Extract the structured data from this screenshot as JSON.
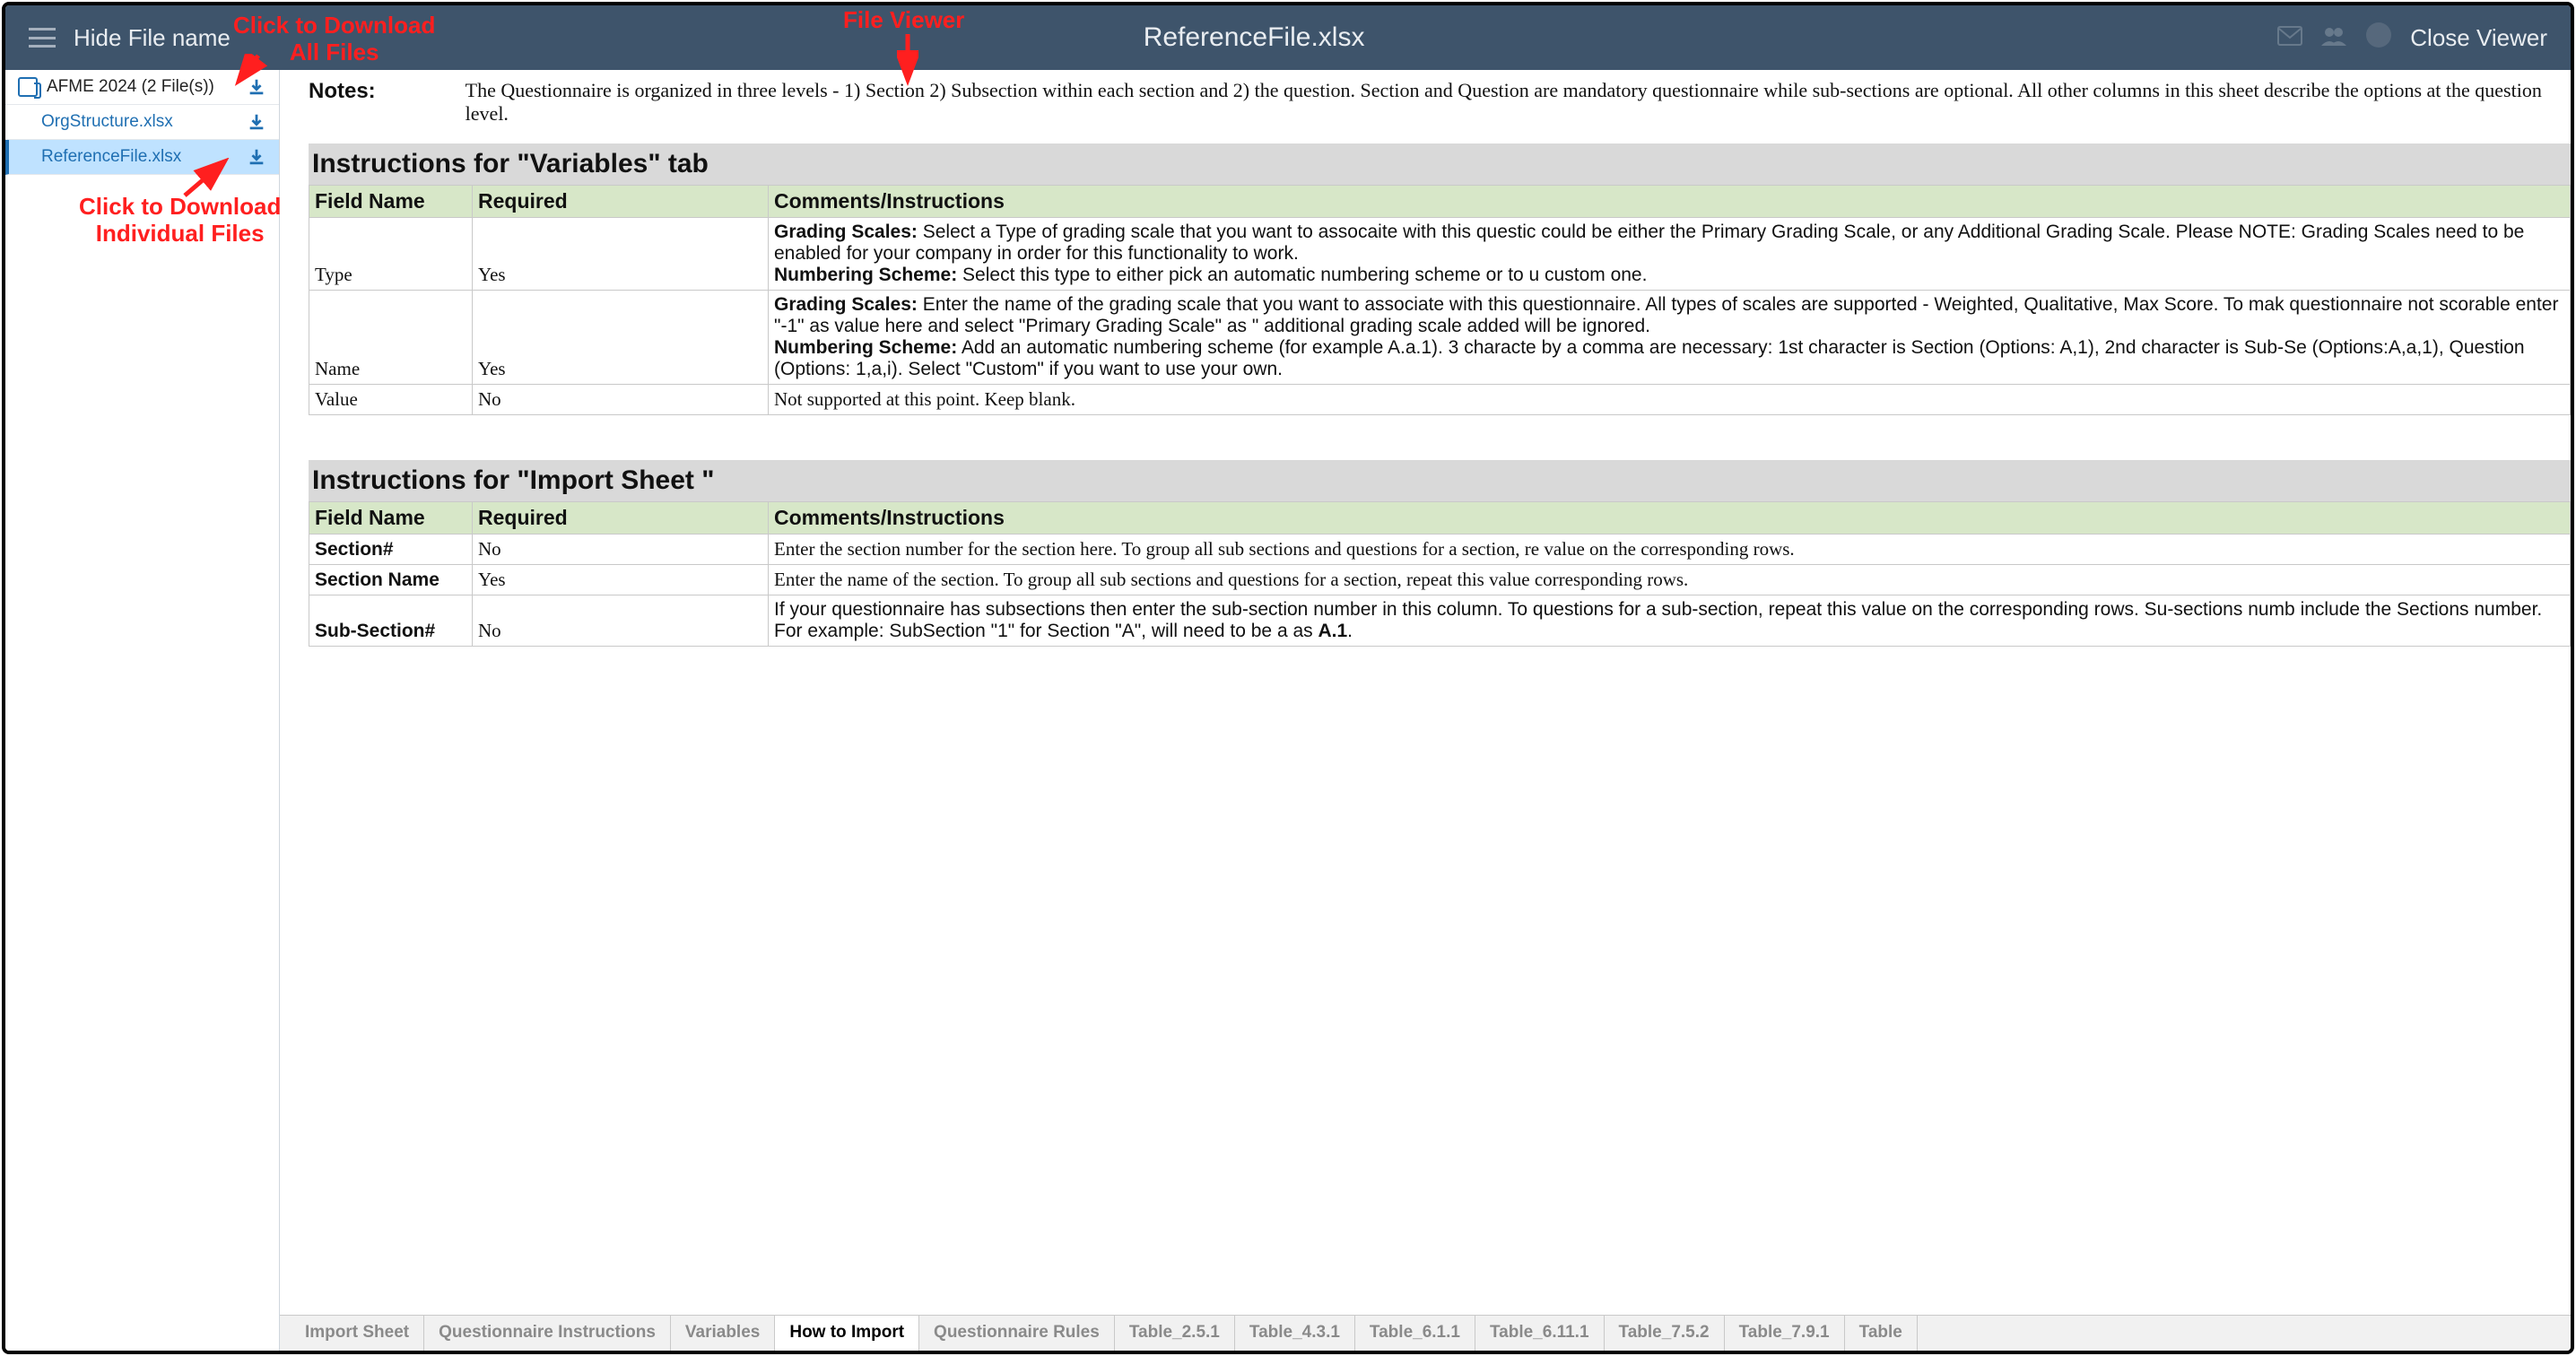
{
  "header": {
    "hide_filename_label": "Hide File name",
    "title": "ReferenceFile.xlsx",
    "close_label": "Close Viewer"
  },
  "sidebar": {
    "folder": {
      "name": "AFME 2024 (2 File(s))"
    },
    "files": [
      {
        "name": "OrgStructure.xlsx",
        "active": false
      },
      {
        "name": "ReferenceFile.xlsx",
        "active": true
      }
    ]
  },
  "document": {
    "notes_label": "Notes:",
    "notes_text": "The Questionnaire is organized in three levels - 1) Section 2) Subsection within each section and 2) the question. Section and Question are mandatory questionnaire while sub-sections are optional. All other columns in this sheet describe the options at the question level.",
    "sections": [
      {
        "title": "Instructions for \"Variables\" tab",
        "headers": [
          "Field Name",
          "Required",
          "Comments/Instructions"
        ],
        "rows": [
          {
            "field": "Type",
            "required": "Yes",
            "comments_html": "<b>Grading Scales:</b> Select a Type of grading scale that you want to assocaite with this questic could be either the Primary Grading Scale, or any Additional Grading Scale. Please NOTE: Grading Scales need to be enabled for your company in order for this functionality to work. <br><b>Numbering Scheme:</b> Select this type to either pick an automatic numbering scheme or to u custom one.",
            "serif": false
          },
          {
            "field": "Name",
            "required": "Yes",
            "comments_html": "<b>Grading Scales:</b> Enter the name of the grading scale that you want to associate with this questionnaire. All types of scales are supported - Weighted, Qualitative, Max Score. To mak questionnaire not scorable enter \"-1\" as value here and select \"Primary Grading Scale\" as \" additional grading scale added will be ignored.<br><b>Numbering Scheme:</b> Add an automatic numbering scheme (for example A.a.1). 3 characte by a comma are necessary: 1st character is Section (Options: A,1), 2nd character is Sub-Se (Options:A,a,1), Question (Options: 1,a,i). Select \"Custom\" if you want to use your own.",
            "serif": false
          },
          {
            "field": "Value",
            "required": "No",
            "comments_html": "Not supported at this point. Keep blank.",
            "serif": true
          }
        ]
      },
      {
        "title": "Instructions for \"Import Sheet \"",
        "headers": [
          "Field Name",
          "Required",
          "Comments/Instructions"
        ],
        "rows": [
          {
            "field": "Section#",
            "required": "No",
            "comments_html": "Enter the section number for the section here. To group all sub sections and questions for a section, re value on the corresponding rows.",
            "serif": true,
            "bold_field": true
          },
          {
            "field": "Section Name",
            "required": "Yes",
            "comments_html": "Enter the name of the section. To group all sub sections and questions for a section, repeat this value corresponding rows.",
            "serif": true,
            "bold_field": true
          },
          {
            "field": "Sub-Section#",
            "required": "No",
            "comments_html": "If your questionnaire has subsections then enter the sub-section number in this column. To questions for a sub-section, repeat this value on the corresponding rows. Su-sections numb include the Sections number. For example: SubSection \"1\" for Section \"A\", will need to be a as <b>A.1</b>.",
            "serif": false,
            "bold_field": true
          }
        ]
      }
    ]
  },
  "tabs": {
    "items": [
      "Import Sheet",
      "Questionnaire Instructions",
      "Variables",
      "How to Import",
      "Questionnaire Rules",
      "Table_2.5.1",
      "Table_4.3.1",
      "Table_6.1.1",
      "Table_6.11.1",
      "Table_7.5.2",
      "Table_7.9.1",
      "Table"
    ],
    "active_index": 3
  },
  "callouts": {
    "download_all": "Click to Download\nAll Files",
    "download_individual": "Click to Download\nIndividual Files",
    "file_viewer": "File Viewer"
  }
}
